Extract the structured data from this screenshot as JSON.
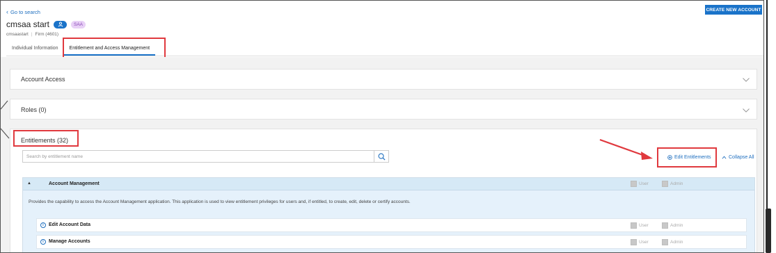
{
  "header": {
    "back_link": "Go to search",
    "create_button": "CREATE NEW ACCOUNT",
    "user_name": "cmsaa start",
    "badge_saa": "SAA",
    "username": "cmsaastart",
    "firm": "Firm (4601)"
  },
  "tabs": [
    {
      "label": "Individual Information"
    },
    {
      "label": "Entitlement and Access Management"
    }
  ],
  "panels": {
    "account_access": "Account Access",
    "roles": "Roles (0)",
    "entitlements": "Entitlements (32)"
  },
  "search": {
    "placeholder": "Search by entitlement name"
  },
  "actions": {
    "edit_entitlements": "Edit Entitlements",
    "collapse_all": "Collapse All"
  },
  "account_management": {
    "label": "Account Management",
    "description": "Provides the capability to access the Account Management application. This application is used to view entitlement privileges for users and, if entitled, to create, edit, delete or certify accounts.",
    "user": "User",
    "admin": "Admin",
    "items": [
      {
        "label": "Edit Account Data",
        "user": "User",
        "admin": "Admin"
      },
      {
        "label": "Manage Accounts",
        "user": "User",
        "admin": "Admin"
      }
    ]
  },
  "colors": {
    "accent": "#1a73c9",
    "highlight": "#e0393e",
    "section_bg": "#e5f1fb"
  }
}
